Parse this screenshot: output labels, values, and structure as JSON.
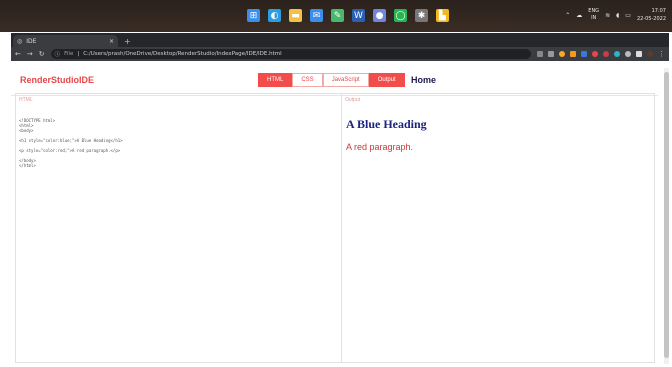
{
  "taskbar": {
    "apps": [
      {
        "icon": "windows-start-icon",
        "color": "#3b8eea",
        "glyph": "⊞"
      },
      {
        "icon": "edge-icon",
        "color": "#2f9be0",
        "glyph": "◐"
      },
      {
        "icon": "file-explorer-icon",
        "color": "#f4c242",
        "glyph": "▬"
      },
      {
        "icon": "mail-icon",
        "color": "#3b8eea",
        "glyph": "✉"
      },
      {
        "icon": "feather-icon",
        "color": "#49b86a",
        "glyph": "✎"
      },
      {
        "icon": "word-icon",
        "color": "#2b5fb3",
        "glyph": "W"
      },
      {
        "icon": "chrome-icon",
        "color": "#6f86e0",
        "glyph": "●"
      },
      {
        "icon": "green-app-icon",
        "color": "#29b359",
        "glyph": "◯"
      },
      {
        "icon": "settings-icon",
        "color": "#777",
        "glyph": "✱"
      },
      {
        "icon": "sticky-icon",
        "color": "#f2b822",
        "glyph": "▙"
      }
    ],
    "lang_top": "ENG",
    "lang_bottom": "IN",
    "time": "17:07",
    "date": "22-05-2022"
  },
  "browser": {
    "tab_title": "IDE",
    "tab_close": "×",
    "new_tab": "+",
    "file_label": "File",
    "url": "C:/Users/prash/OneDrive/Desktop/RenderStudio/IndexPage/IDE/IDE.html"
  },
  "app": {
    "brand": "RenderStudioIDE",
    "modes": [
      "HTML",
      "CSS",
      "JavaScript",
      "Output"
    ],
    "home": "Home",
    "left_label": "HTML",
    "right_label": "Output",
    "code": "<!DOCTYPE html>\n<html>\n<body>\n\n<h1 style=\"color:blue;\">A Blue Heading</h1>\n\n<p style=\"color:red;\">A red paragraph.</p>\n\n</body>\n</html>",
    "output_heading": "A Blue Heading",
    "output_paragraph": "A red paragraph."
  }
}
